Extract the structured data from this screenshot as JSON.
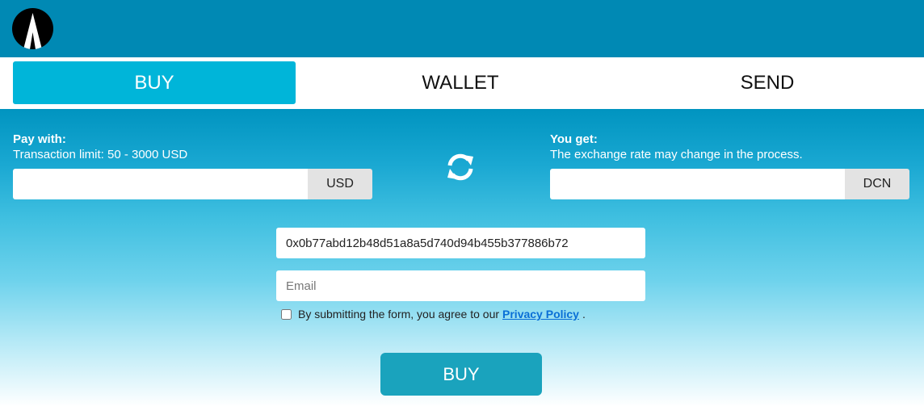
{
  "header": {
    "logo_icon": "peak-logo-icon",
    "brand_color": "#0089b4"
  },
  "tabs": [
    {
      "label": "BUY",
      "active": true
    },
    {
      "label": "WALLET",
      "active": false
    },
    {
      "label": "SEND",
      "active": false
    }
  ],
  "pay": {
    "title": "Pay with:",
    "subtitle": "Transaction limit: 50 - 3000 USD",
    "value": "",
    "currency": "USD"
  },
  "swap_icon": "refresh-icon",
  "get": {
    "title": "You get:",
    "subtitle": "The exchange rate may change in the process.",
    "value": "",
    "currency": "DCN"
  },
  "wallet_address": {
    "value": "0x0b77abd12b48d51a8a5d740d94b455b377886b72"
  },
  "email": {
    "value": "",
    "placeholder": "Email"
  },
  "agreement": {
    "checked": false,
    "text": "By submitting the form, you agree to our",
    "link": "Privacy Policy",
    "suffix": "."
  },
  "submit": {
    "label": "BUY"
  },
  "colors": {
    "active_tab": "#00b5d9",
    "button": "#1aa3bd",
    "link": "#0a6fd6"
  }
}
